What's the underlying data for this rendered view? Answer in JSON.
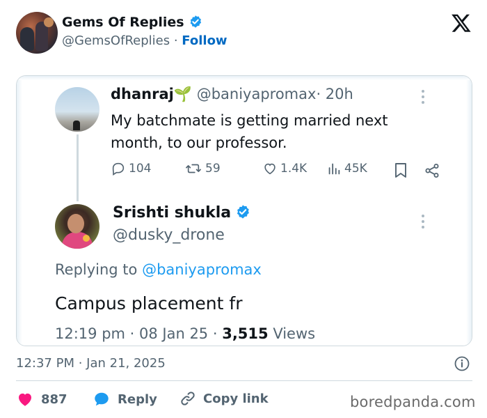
{
  "outer_tweet": {
    "author_name": "Gems Of Replies",
    "handle": "@GemsOfReplies",
    "separator": "·",
    "follow_label": "Follow",
    "timestamp": "12:37 PM · Jan 21, 2025",
    "likes_count": "887",
    "reply_label": "Reply",
    "copy_link_label": "Copy link"
  },
  "embedded": {
    "tweet1": {
      "name": "dhanraj",
      "emoji": "🌱",
      "handle": "@baniyapromax",
      "age": "· 20h",
      "text": "My batchmate is getting married next month, to our professor.",
      "replies": "104",
      "reposts": "59",
      "likes": "1.4K",
      "views": "45K"
    },
    "tweet2": {
      "name": "Srishti shukla",
      "handle": "@dusky_drone",
      "replying_prefix": "Replying to ",
      "replying_mention": "@baniyapromax",
      "text": "Campus placement fr",
      "time": "12:19 pm · 08 Jan 25 · ",
      "views_count": "3,515",
      "views_label": " Views"
    }
  },
  "watermark": "boredpanda.com",
  "colors": {
    "accent_blue": "#1d9bf0",
    "follow_blue": "#0069c2",
    "like_pink": "#f91880",
    "muted_text": "#536471"
  }
}
